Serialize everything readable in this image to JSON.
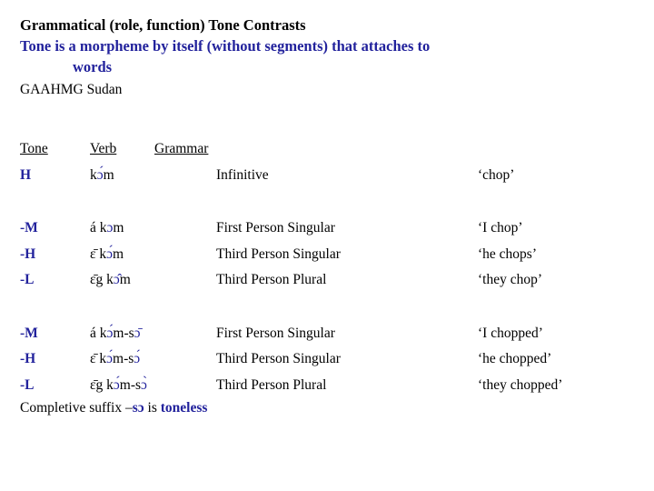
{
  "heading": {
    "title": "Grammatical (role, function) Tone Contrasts",
    "subtitle": "Tone is a morpheme by itself (without segments) that attaches to",
    "subtitle_cont": "words",
    "source": "GAAHMG Sudan",
    "title_color": "#000000",
    "subtitle_color": "#22229c"
  },
  "table": {
    "headers": {
      "tone": "Tone",
      "verb": "Verb",
      "grammar": "Grammar"
    },
    "blocks": [
      {
        "rows": [
          {
            "tone": "H",
            "verb_prefix": "",
            "verb_stem": "k",
            "verb_vowel": "ɔ́",
            "verb_tail": "m",
            "grammar": "Infinitive",
            "gloss": "‘chop’"
          }
        ]
      },
      {
        "rows": [
          {
            "tone": "-M",
            "verb_prefix": "á  ",
            "verb_stem": "k",
            "verb_vowel": "ɔ",
            "verb_tail": "m",
            "grammar": "First Person Singular",
            "gloss": "‘I chop’"
          },
          {
            "tone": "-H",
            "verb_prefix": "ɛ̄  ",
            "verb_stem": "k",
            "verb_vowel": "ɔ́",
            "verb_tail": "m",
            "grammar": "Third Person Singular",
            "gloss": "‘he chops’"
          },
          {
            "tone": "-L",
            "verb_prefix": "ɛ̄g ",
            "verb_stem": "k",
            "verb_vowel": "ɔ̂",
            "verb_tail": "m",
            "grammar": "Third Person Plural",
            "gloss": "‘they chop’"
          }
        ]
      },
      {
        "rows": [
          {
            "tone": "-M",
            "verb_prefix": "á  ",
            "verb_stem": "k",
            "verb_vowel": "ɔ́",
            "verb_tail": "m-s",
            "verb_suffix_vowel": "ɔ̄",
            "grammar": "First Person Singular",
            "gloss": "‘I chopped’"
          },
          {
            "tone": "-H",
            "verb_prefix": "ɛ̄  ",
            "verb_stem": "k",
            "verb_vowel": "ɔ́",
            "verb_tail": "m-s",
            "verb_suffix_vowel": "ɔ́",
            "grammar": "Third Person Singular",
            "gloss": "‘he chopped’"
          },
          {
            "tone": "-L",
            "verb_prefix": "ɛ̄g ",
            "verb_stem": "k",
            "verb_vowel": "ɔ́",
            "verb_tail": "m-s",
            "verb_suffix_vowel": "ɔ̀",
            "grammar": "Third Person Plural",
            "gloss": "‘they chopped’"
          }
        ]
      }
    ]
  },
  "footer": {
    "text_1": "Completive suffix –",
    "suffix": "sɔ",
    "text_2": " is ",
    "emphasis": "toneless"
  }
}
